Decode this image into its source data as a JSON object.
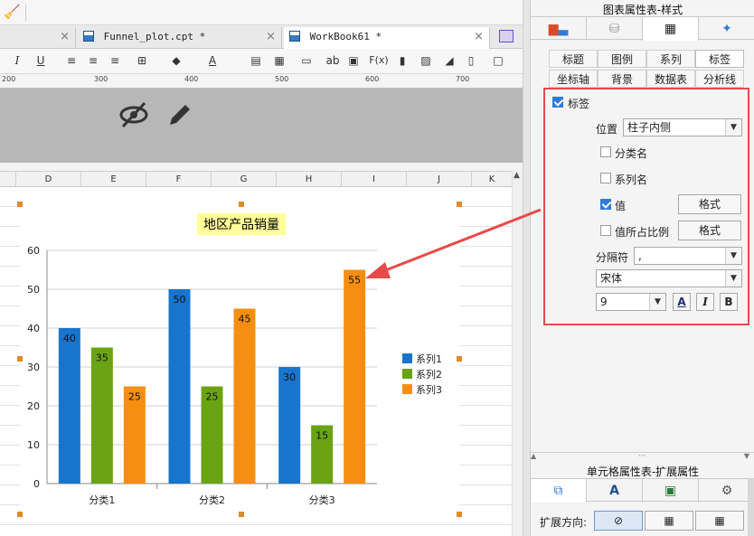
{
  "tabs": [
    {
      "label": "Funnel_plot.cpt *",
      "close": "×"
    },
    {
      "label": "WorkBook61 *",
      "close": "×"
    }
  ],
  "toolbar": [
    "I",
    "U",
    "ab",
    "F(x)"
  ],
  "ruler": [
    "200",
    "300",
    "400",
    "500",
    "600",
    "700"
  ],
  "columns": [
    "D",
    "E",
    "F",
    "G",
    "H",
    "I",
    "J",
    "K"
  ],
  "chart_data": {
    "type": "bar",
    "title": "地区产品销量",
    "categories": [
      "分类1",
      "分类2",
      "分类3"
    ],
    "series": [
      {
        "name": "系列1",
        "values": [
          40,
          50,
          30
        ],
        "color": "#1874cd"
      },
      {
        "name": "系列2",
        "values": [
          35,
          25,
          15
        ],
        "color": "#6aa314"
      },
      {
        "name": "系列3",
        "values": [
          25,
          45,
          55
        ],
        "color": "#f68e12"
      }
    ],
    "ylim": [
      0,
      60
    ],
    "yticks": [
      "0",
      "10",
      "20",
      "30",
      "40",
      "50",
      "60"
    ],
    "grid": true,
    "legend": "right",
    "title_bg": "#ffff99"
  },
  "panel": {
    "title": "图表属性表-样式",
    "subtabs_row1": [
      "标题",
      "图例",
      "系列",
      "标签"
    ],
    "subtabs_row2": [
      "坐标轴",
      "背景",
      "数据表",
      "分析线"
    ],
    "active_subtab": "标签",
    "label_enable": "标签",
    "position_label": "位置",
    "position_value": "柱子内侧",
    "opt_category": "分类名",
    "opt_series": "系列名",
    "opt_value": "值",
    "opt_percent": "值所占比例",
    "format_btn1": "格式",
    "format_btn2": "格式",
    "separator_label": "分隔符",
    "separator_value": ",",
    "font_value": "宋体",
    "size_value": "9",
    "style_a": "A",
    "style_i": "I",
    "style_b": "B",
    "ext_title": "单元格属性表-扩展属性",
    "ext_dir_label": "扩展方向:",
    "dots": "···"
  }
}
